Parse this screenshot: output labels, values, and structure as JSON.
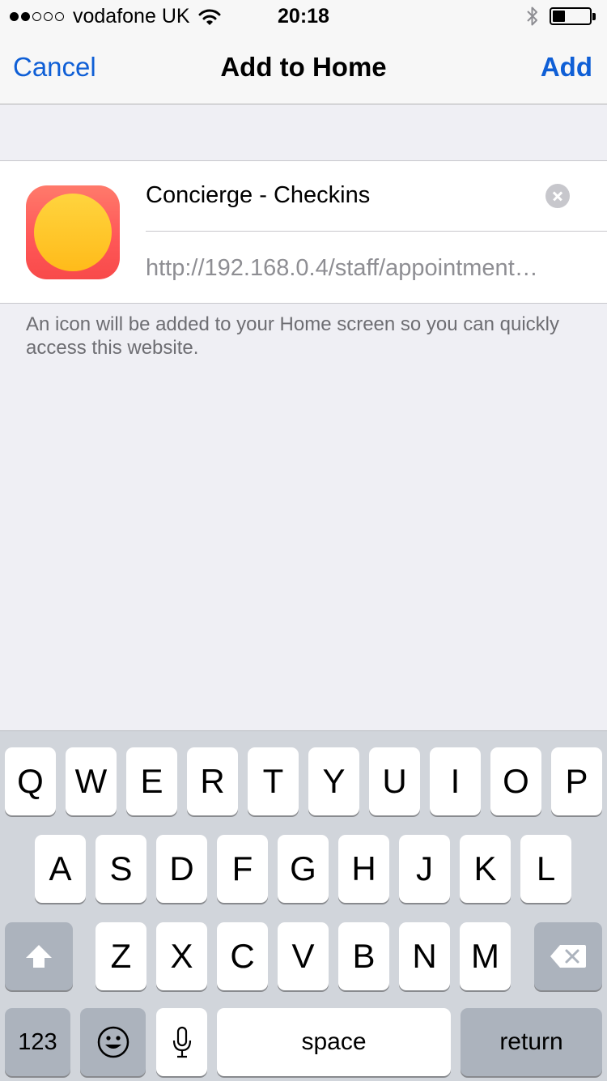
{
  "status_bar": {
    "carrier": "vodafone UK",
    "time": "20:18",
    "signal_dots_filled": 2,
    "signal_dots_total": 5,
    "battery_level": 0.35
  },
  "nav": {
    "cancel_label": "Cancel",
    "title": "Add to Home",
    "add_label": "Add"
  },
  "form": {
    "title_value": "Concierge - Checkins",
    "url_value": "http://192.168.0.4/staff/appointment…",
    "footer_note": "An icon will be added to your Home screen so you can quickly access this website."
  },
  "keyboard": {
    "row1": [
      "Q",
      "W",
      "E",
      "R",
      "T",
      "Y",
      "U",
      "I",
      "O",
      "P"
    ],
    "row2": [
      "A",
      "S",
      "D",
      "F",
      "G",
      "H",
      "J",
      "K",
      "L"
    ],
    "row3": [
      "Z",
      "X",
      "C",
      "V",
      "B",
      "N",
      "M"
    ],
    "numbers_label": "123",
    "space_label": "space",
    "return_label": "return"
  },
  "colors": {
    "accent": "#0f5fd6",
    "background": "#efeff4",
    "keyboard_bg": "#d1d5db",
    "app_icon_red": "#ff5858",
    "app_icon_yellow": "#ffc62a"
  },
  "icons": [
    "wifi-icon",
    "bluetooth-icon",
    "battery-icon",
    "clear-icon",
    "shift-icon",
    "delete-icon",
    "emoji-icon",
    "microphone-icon"
  ]
}
